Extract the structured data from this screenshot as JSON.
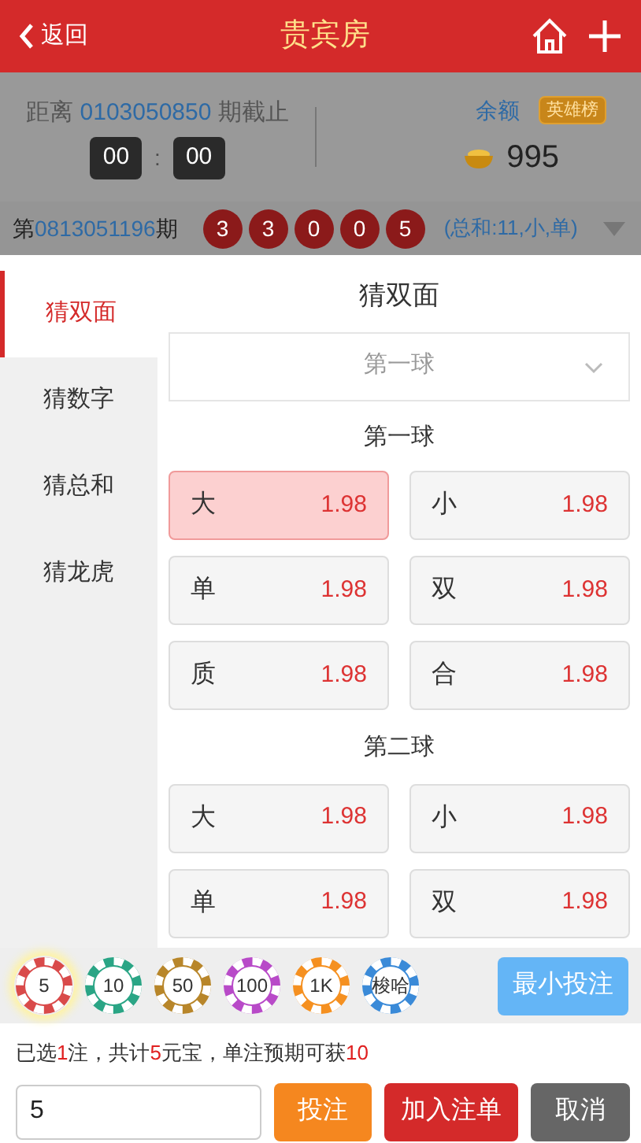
{
  "header": {
    "back_label": "返回",
    "title": "贵宾房"
  },
  "countdown": {
    "prefix": "距离",
    "issue": "0103050850",
    "suffix": "期截止",
    "minutes": "00",
    "separator": ":",
    "seconds": "00"
  },
  "balance": {
    "label": "余额",
    "badge": "英雄榜",
    "amount": "995"
  },
  "last_draw": {
    "prefix": "第",
    "issue": "0813051196",
    "suffix": "期",
    "balls": [
      "3",
      "3",
      "0",
      "0",
      "5"
    ],
    "summary": "(总和:11,小,单)"
  },
  "sidebar": {
    "items": [
      {
        "label": "猜双面",
        "selected": true
      },
      {
        "label": "猜数字",
        "selected": false
      },
      {
        "label": "猜总和",
        "selected": false
      },
      {
        "label": "猜龙虎",
        "selected": false
      }
    ]
  },
  "panel": {
    "title": "猜双面",
    "dropdown": {
      "value": "第一球"
    },
    "groups": [
      {
        "title": "第一球",
        "options": [
          {
            "label": "大",
            "odds": "1.98",
            "selected": true
          },
          {
            "label": "小",
            "odds": "1.98",
            "selected": false
          },
          {
            "label": "单",
            "odds": "1.98",
            "selected": false
          },
          {
            "label": "双",
            "odds": "1.98",
            "selected": false
          },
          {
            "label": "质",
            "odds": "1.98",
            "selected": false
          },
          {
            "label": "合",
            "odds": "1.98",
            "selected": false
          }
        ]
      },
      {
        "title": "第二球",
        "options": [
          {
            "label": "大",
            "odds": "1.98",
            "selected": false
          },
          {
            "label": "小",
            "odds": "1.98",
            "selected": false
          },
          {
            "label": "单",
            "odds": "1.98",
            "selected": false
          },
          {
            "label": "双",
            "odds": "1.98",
            "selected": false
          }
        ]
      }
    ]
  },
  "chips": [
    {
      "label": "5",
      "color": "#d94a4a",
      "selected": true
    },
    {
      "label": "10",
      "color": "#2aa585",
      "selected": false
    },
    {
      "label": "50",
      "color": "#b8862a",
      "selected": false
    },
    {
      "label": "100",
      "color": "#b84ac8",
      "selected": false
    },
    {
      "label": "1K",
      "color": "#f59020",
      "selected": false
    },
    {
      "label": "梭哈",
      "color": "#3a8ad8",
      "selected": false
    }
  ],
  "min_bet_button": "最小投注",
  "summary": [
    {
      "text": "已选",
      "highlight": false
    },
    {
      "text": "1",
      "highlight": true
    },
    {
      "text": "注，共计",
      "highlight": false
    },
    {
      "text": "5",
      "highlight": true
    },
    {
      "text": "元宝，单注预期可获",
      "highlight": false
    },
    {
      "text": "10",
      "highlight": true
    }
  ],
  "amount_input": {
    "value": "5"
  },
  "actions": [
    {
      "label": "投注",
      "kind": "bet"
    },
    {
      "label": "加入注单",
      "kind": "add"
    },
    {
      "label": "取消",
      "kind": "cancel"
    }
  ]
}
